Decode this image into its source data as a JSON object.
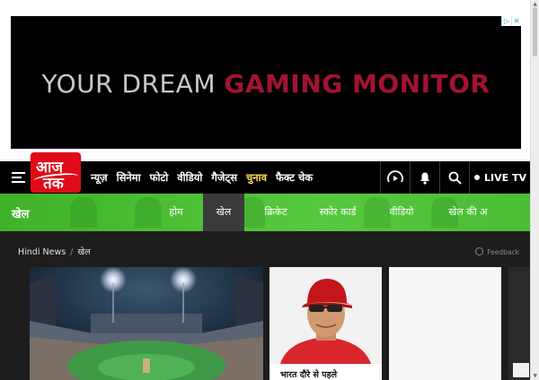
{
  "ad": {
    "text_white": "YOUR DREAM",
    "text_red": "GAMING MONITOR",
    "choices_icons": [
      "adchoices-icon",
      "close-icon"
    ]
  },
  "header": {
    "logo_top": "आज",
    "logo_bottom": "तक",
    "nav_items": [
      {
        "label": "न्यूज़"
      },
      {
        "label": "सिनेमा"
      },
      {
        "label": "फोटो"
      },
      {
        "label": "वीडियो"
      },
      {
        "label": "गैजेट्स"
      },
      {
        "label": "चुनाव",
        "highlight": true
      },
      {
        "label": "फैक्ट चेक"
      }
    ],
    "live_label": "LIVE TV",
    "icons": [
      "audio-player-icon",
      "notification-bell-icon",
      "search-icon"
    ]
  },
  "section": {
    "title": "खेल",
    "tabs": [
      {
        "label": "होम"
      },
      {
        "label": "खेल",
        "active": true
      },
      {
        "label": "क्रिकेट"
      },
      {
        "label": "स्कोर कार्ड"
      },
      {
        "label": "वीडियो"
      },
      {
        "label": "खेल की अ"
      }
    ]
  },
  "breadcrumb": {
    "home": "Hindi News",
    "separator": "/",
    "current": "खेल"
  },
  "feedback_label": "Feedback",
  "cards": [
    {
      "image": "cricket-stadium-night"
    },
    {
      "image": "cricketer-portrait",
      "caption": "भारत दौरे से पहले"
    },
    {
      "image": "blank"
    }
  ],
  "colors": {
    "brand_red": "#e10a17",
    "section_green": "#4bbd35",
    "election_yellow": "#ffe04d",
    "ad_red": "#a31231"
  }
}
